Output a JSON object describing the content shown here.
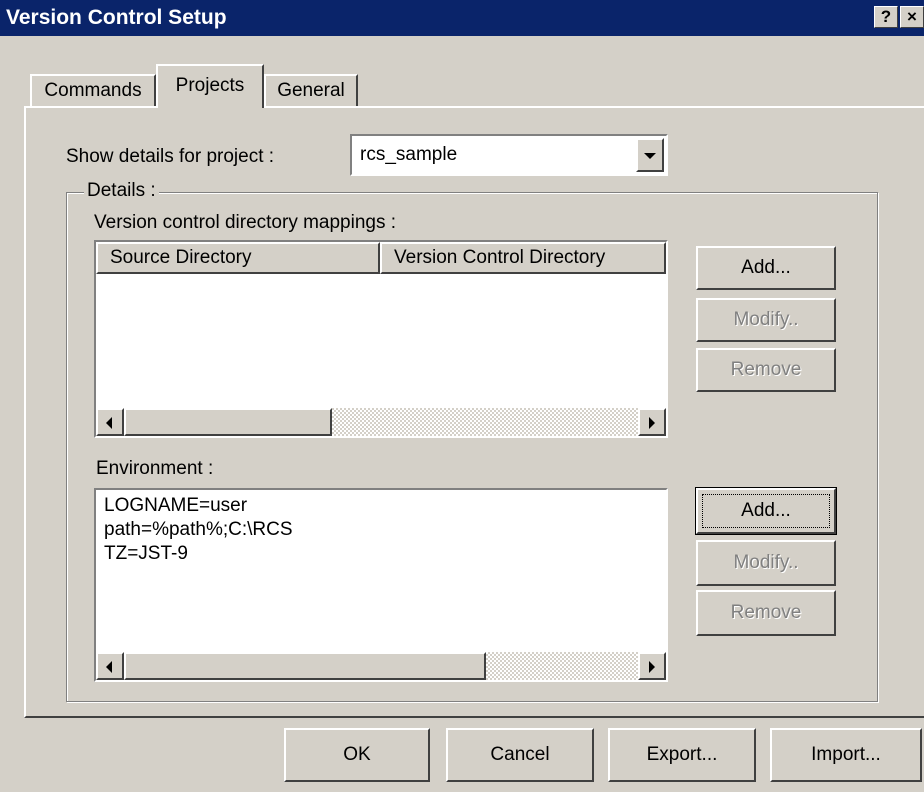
{
  "window": {
    "title": "Version Control Setup",
    "help_glyph": "?",
    "close_glyph": "×"
  },
  "tabs": [
    {
      "label": "Commands"
    },
    {
      "label": "Projects"
    },
    {
      "label": "General"
    }
  ],
  "project": {
    "label": "Show details for project :",
    "selected": "rcs_sample"
  },
  "details": {
    "group_label": "Details :",
    "mappings_label": "Version control directory mappings :",
    "columns": [
      "Source Directory",
      "Version Control Directory"
    ],
    "environment_label": "Environment :",
    "environment_lines": [
      "LOGNAME=user",
      "path=%path%;C:\\RCS",
      "TZ=JST-9"
    ]
  },
  "mapping_buttons": {
    "add": "Add...",
    "modify": "Modify..",
    "remove": "Remove"
  },
  "env_buttons": {
    "add": "Add...",
    "modify": "Modify..",
    "remove": "Remove"
  },
  "footer": {
    "ok": "OK",
    "cancel": "Cancel",
    "export": "Export...",
    "import": "Import..."
  },
  "colors": {
    "titlebar": "#0a246a",
    "face": "#d4d0c8",
    "disabled_text": "#808080"
  }
}
